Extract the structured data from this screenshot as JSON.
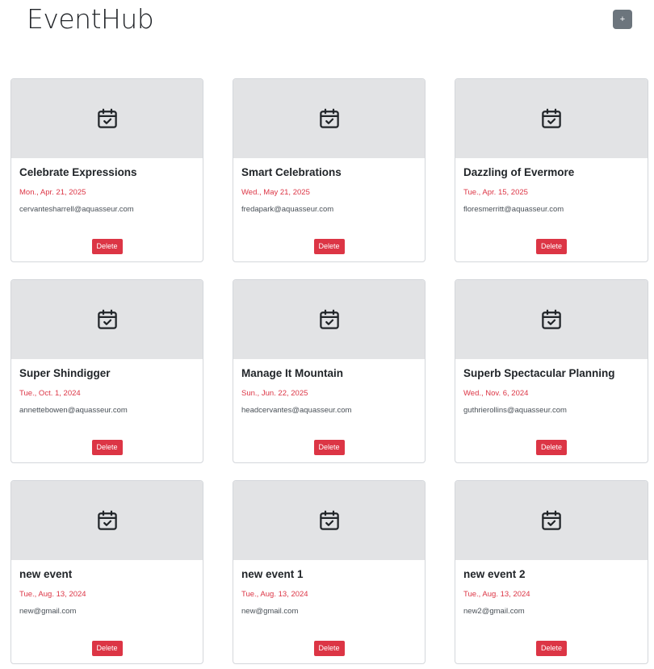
{
  "header": {
    "title": "EventHub",
    "add_label": "+"
  },
  "colors": {
    "delete": "#dc3545",
    "date": "#dc3545",
    "add_button": "#6c757d",
    "banner": "#e2e3e5"
  },
  "card_icon": "calendar-check-icon",
  "events": [
    {
      "title": "Celebrate Expressions",
      "date": "Mon., Apr. 21, 2025",
      "email": "cervantesharrell@aquasseur.com",
      "delete_label": "Delete"
    },
    {
      "title": "Smart Celebrations",
      "date": "Wed., May 21, 2025",
      "email": "fredapark@aquasseur.com",
      "delete_label": "Delete"
    },
    {
      "title": "Dazzling of Evermore",
      "date": "Tue., Apr. 15, 2025",
      "email": "floresmerritt@aquasseur.com",
      "delete_label": "Delete"
    },
    {
      "title": "Super Shindigger",
      "date": "Tue., Oct. 1, 2024",
      "email": "annettebowen@aquasseur.com",
      "delete_label": "Delete"
    },
    {
      "title": "Manage It Mountain",
      "date": "Sun., Jun. 22, 2025",
      "email": "headcervantes@aquasseur.com",
      "delete_label": "Delete"
    },
    {
      "title": "Superb Spectacular Planning",
      "date": "Wed., Nov. 6, 2024",
      "email": "guthrierollins@aquasseur.com",
      "delete_label": "Delete"
    },
    {
      "title": "new event",
      "date": "Tue., Aug. 13, 2024",
      "email": "new@gmail.com",
      "delete_label": "Delete"
    },
    {
      "title": "new event 1",
      "date": "Tue., Aug. 13, 2024",
      "email": "new@gmail.com",
      "delete_label": "Delete"
    },
    {
      "title": "new event 2",
      "date": "Tue., Aug. 13, 2024",
      "email": "new2@gmail.com",
      "delete_label": "Delete"
    }
  ]
}
